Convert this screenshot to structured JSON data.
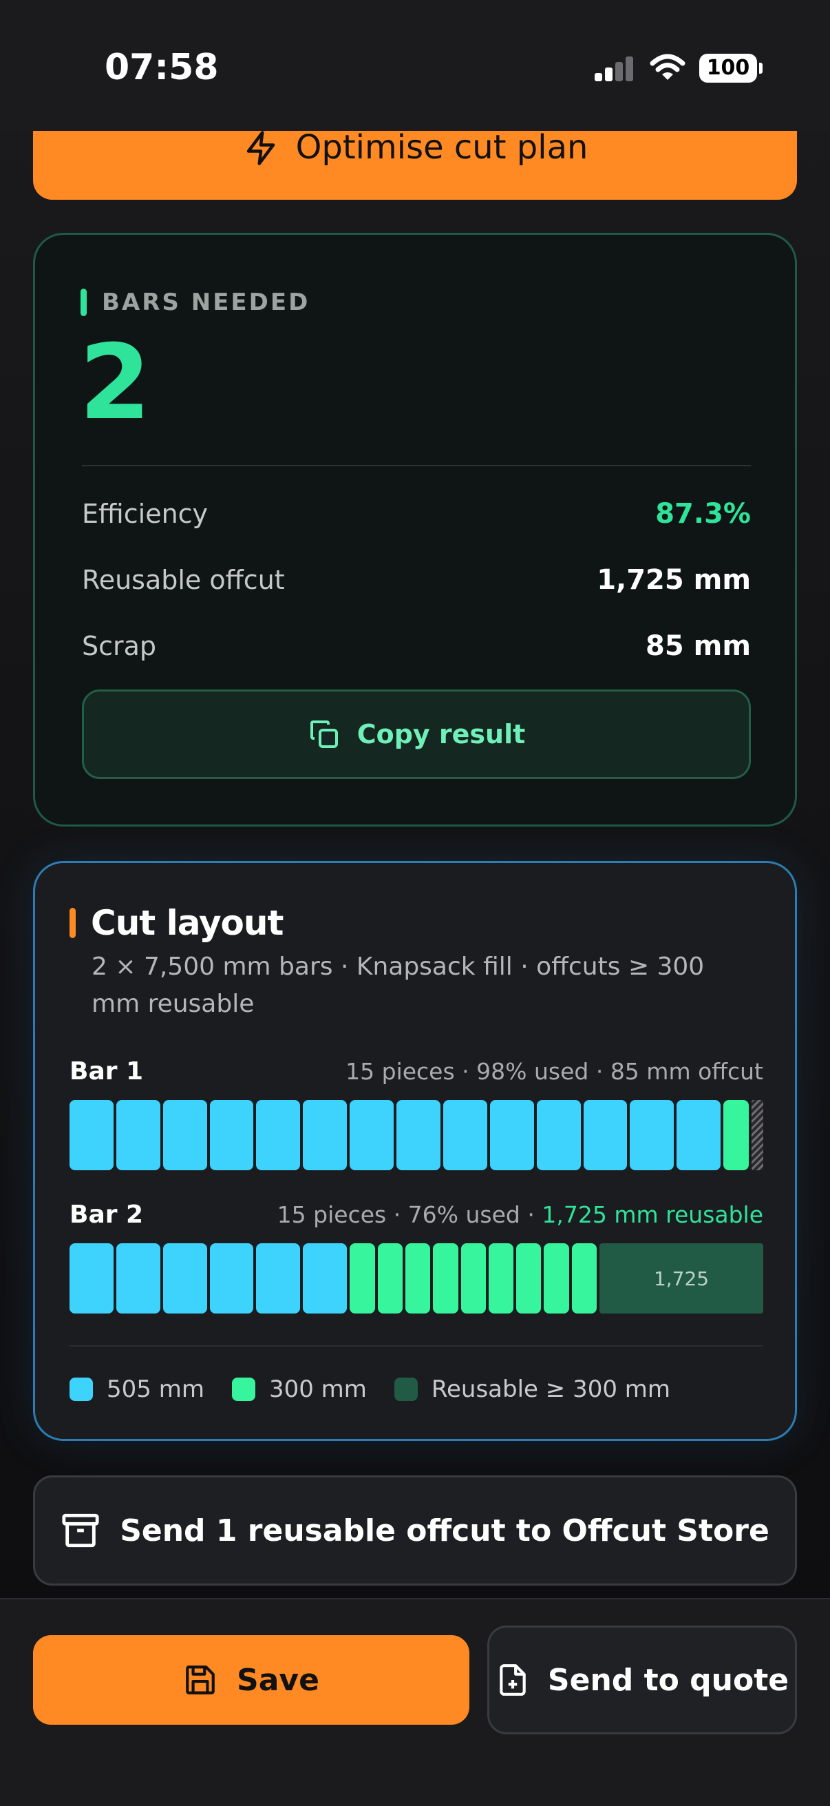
{
  "status_bar": {
    "time": "07:58",
    "battery": "100"
  },
  "optimise_button": {
    "label": "Optimise cut plan"
  },
  "result": {
    "bars_label": "BARS NEEDED",
    "bars_value": "2",
    "stats": [
      {
        "label": "Efficiency",
        "value": "87.3%"
      },
      {
        "label": "Reusable offcut",
        "value": "1,725 mm"
      },
      {
        "label": "Scrap",
        "value": "85 mm"
      }
    ],
    "copy_label": "Copy result"
  },
  "layout": {
    "title": "Cut layout",
    "subtitle": "2 × 7,500 mm bars · Knapsack fill · offcuts ≥ 300 mm reusable",
    "bars": [
      {
        "name": "Bar 1",
        "meta": "15 pieces · 98% used · 85 mm offcut",
        "meta_highlight": "",
        "length_mm": 7500,
        "pieces_505": 14,
        "pieces_300": 1,
        "remainder_mm": 85,
        "remainder_type": "scrap",
        "remainder_label": ""
      },
      {
        "name": "Bar 2",
        "meta": "15 pieces · 76% used · ",
        "meta_highlight": "1,725 mm reusable",
        "length_mm": 7500,
        "pieces_505": 6,
        "pieces_300": 9,
        "remainder_mm": 1725,
        "remainder_type": "reusable",
        "remainder_label": "1,725"
      }
    ],
    "legend": [
      {
        "label": "505 mm",
        "color": "#3dd3fd"
      },
      {
        "label": "300 mm",
        "color": "#37f59c"
      },
      {
        "label": "Reusable ≥ 300 mm",
        "color": "#215a45"
      }
    ]
  },
  "send_offcut": {
    "label": "Send 1 reusable offcut to Offcut Store"
  },
  "bottom": {
    "save_label": "Save",
    "quote_label": "Send to quote"
  },
  "colors": {
    "accent": "#ff8a24",
    "success": "#2fe39a",
    "piece_505": "#3dd3fd",
    "piece_300": "#37f59c",
    "reusable": "#215a45"
  }
}
